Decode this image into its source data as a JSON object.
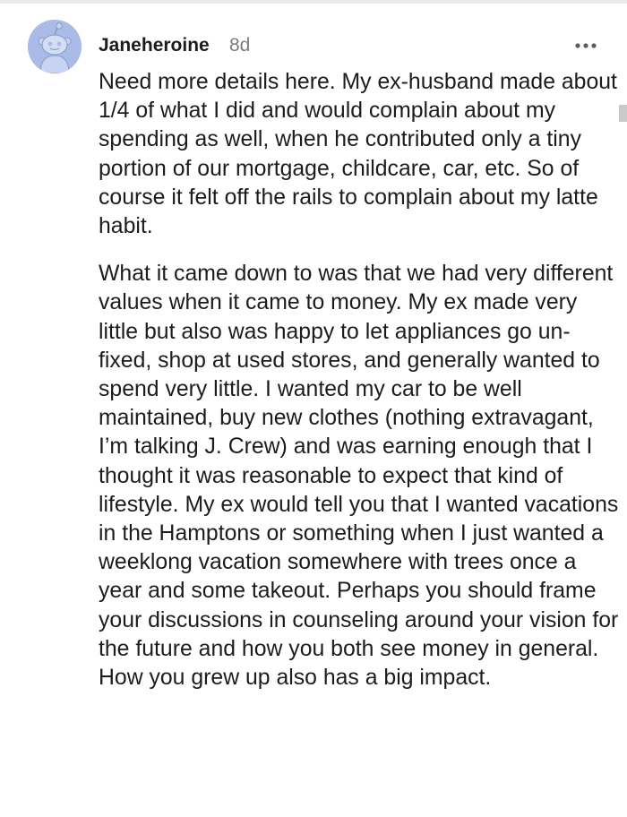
{
  "comment": {
    "author": "Janeheroine",
    "timestamp": "8d",
    "more_icon": "more-horizontal-icon",
    "avatar_icon": "snoo-avatar-icon",
    "paragraphs": [
      "Need more details here. My ex-husband made about 1/4 of what I did and would complain about my spending as well, when he contributed only a tiny portion of our mortgage, childcare, car, etc. So of course it felt off the rails to complain about my latte habit.",
      "What it came down to was that we had very different values when it came to money. My ex made very little but also was happy to let appliances go un-fixed, shop at used stores, and generally wanted to spend very little. I wanted my car to be well maintained, buy new clothes (nothing extravagant, I’m talking J. Crew) and was earning enough that I thought it was reasonable to expect that kind of lifestyle. My ex would tell you that I wanted vacations in the Hamptons or something when I just wanted a weeklong vacation somewhere with trees once a year and some takeout. Perhaps you should frame your discussions in counseling around your vision for the future and how you both see money in general. How you grew up also has a big impact."
    ]
  },
  "colors": {
    "avatar_background": "#a9bbe6",
    "username": "#1c1c1c",
    "timestamp": "#7c7c7c",
    "body_text": "#1c1c1c"
  }
}
